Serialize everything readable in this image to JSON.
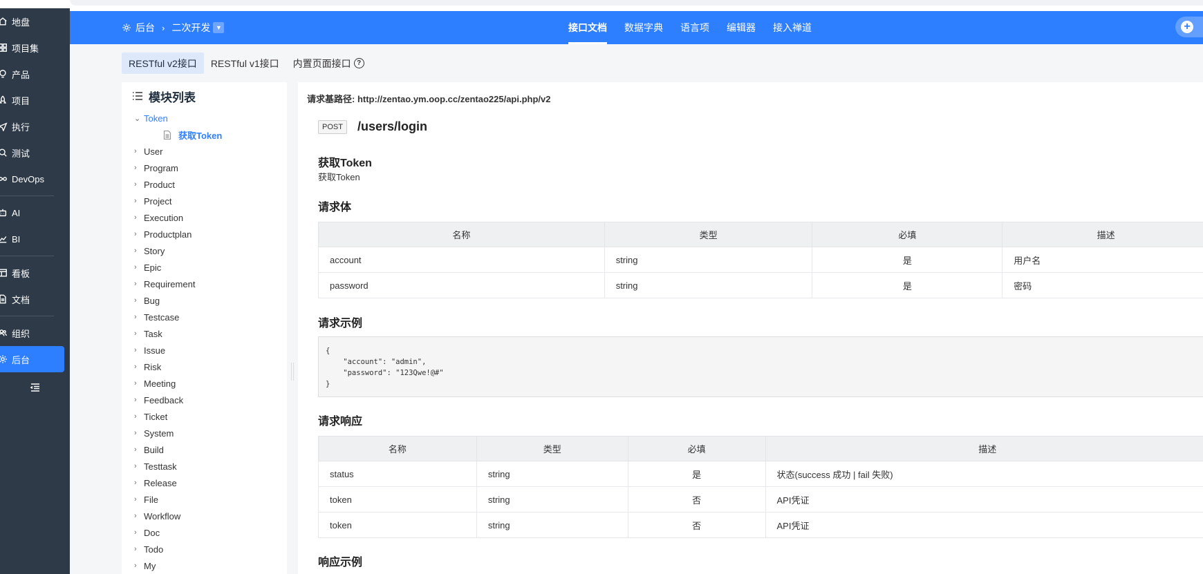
{
  "sidebar": {
    "items": [
      {
        "label": "地盘",
        "icon": "home-icon"
      },
      {
        "label": "项目集",
        "icon": "grid-icon"
      },
      {
        "label": "产品",
        "icon": "lightbulb-icon"
      },
      {
        "label": "项目",
        "icon": "rocket-icon"
      },
      {
        "label": "执行",
        "icon": "send-icon"
      },
      {
        "label": "测试",
        "icon": "search-icon"
      },
      {
        "label": "DevOps",
        "icon": "infinity-icon"
      },
      {
        "label": "AI",
        "icon": "robot-icon"
      },
      {
        "label": "BI",
        "icon": "chart-icon"
      },
      {
        "label": "看板",
        "icon": "kanban-icon"
      },
      {
        "label": "文档",
        "icon": "doc-icon"
      },
      {
        "label": "组织",
        "icon": "people-icon"
      },
      {
        "label": "后台",
        "icon": "gear-icon"
      }
    ],
    "active": "后台"
  },
  "header": {
    "breadcrumb_root": "后台",
    "breadcrumb_current": "二次开发",
    "menu": [
      "接口文档",
      "数据字典",
      "语言项",
      "编辑器",
      "接入禅道"
    ],
    "active_menu": "接口文档"
  },
  "subtabs": {
    "items": [
      "RESTful v2接口",
      "RESTful v1接口",
      "内置页面接口"
    ],
    "help": "?"
  },
  "module_panel": {
    "title": "模块列表",
    "open_module": "Token",
    "open_child": "获取Token",
    "modules": [
      "User",
      "Program",
      "Product",
      "Project",
      "Execution",
      "Productplan",
      "Story",
      "Epic",
      "Requirement",
      "Bug",
      "Testcase",
      "Task",
      "Issue",
      "Risk",
      "Meeting",
      "Feedback",
      "Ticket",
      "System",
      "Build",
      "Testtask",
      "Release",
      "File",
      "Workflow",
      "Doc",
      "Todo",
      "My"
    ]
  },
  "main": {
    "base_path": "请求基路径: http://zentao.ym.oop.cc/zentao225/api.php/v2",
    "method": "POST",
    "path": "/users/login",
    "title": "获取Token",
    "desc": "获取Token",
    "request_body_title": "请求体",
    "request_body_headers": [
      "名称",
      "类型",
      "必填",
      "描述"
    ],
    "request_body_rows": [
      [
        "account",
        "string",
        "是",
        "用户名"
      ],
      [
        "password",
        "string",
        "是",
        "密码"
      ]
    ],
    "request_example_title": "请求示例",
    "request_example_code": "{\n    \"account\": \"admin\",\n    \"password\": \"123Qwe!@#\"\n}",
    "response_title": "请求响应",
    "response_headers": [
      "名称",
      "类型",
      "必填",
      "描述"
    ],
    "response_rows": [
      [
        "status",
        "string",
        "是",
        "状态(success 成功 | fail 失败)"
      ],
      [
        "token",
        "string",
        "否",
        "API凭证"
      ],
      [
        "token",
        "string",
        "否",
        "API凭证"
      ]
    ],
    "response_example_title": "响应示例"
  }
}
